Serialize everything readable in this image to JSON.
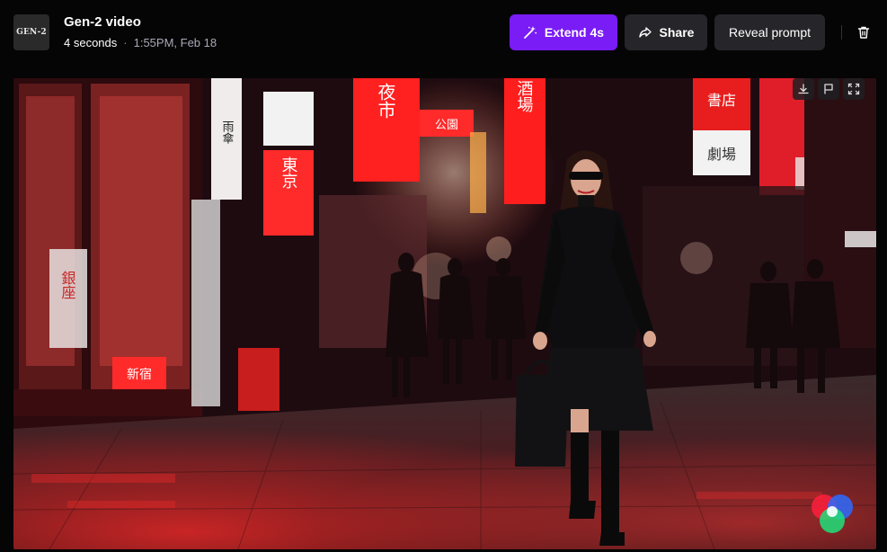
{
  "header": {
    "thumbnail_text": "GEN-2",
    "title": "Gen-2 video",
    "duration": "4 seconds",
    "separator": "·",
    "timestamp": "1:55PM, Feb 18"
  },
  "actions": {
    "extend_label": "Extend 4s",
    "share_label": "Share",
    "reveal_label": "Reveal prompt"
  },
  "video": {
    "signs": [
      "雨傘",
      "東京",
      "夜市",
      "酒場",
      "書店",
      "劇場",
      "銀座",
      "新宿",
      "公園"
    ]
  },
  "colors": {
    "accent": "#7a1cf6",
    "button_bg": "#26262a",
    "background": "#050505"
  },
  "icons": {
    "extend": "magic-wand-icon",
    "share": "share-arrow-icon",
    "delete": "trash-icon",
    "download": "download-icon",
    "flag": "flag-icon",
    "fullscreen": "expand-icon"
  }
}
